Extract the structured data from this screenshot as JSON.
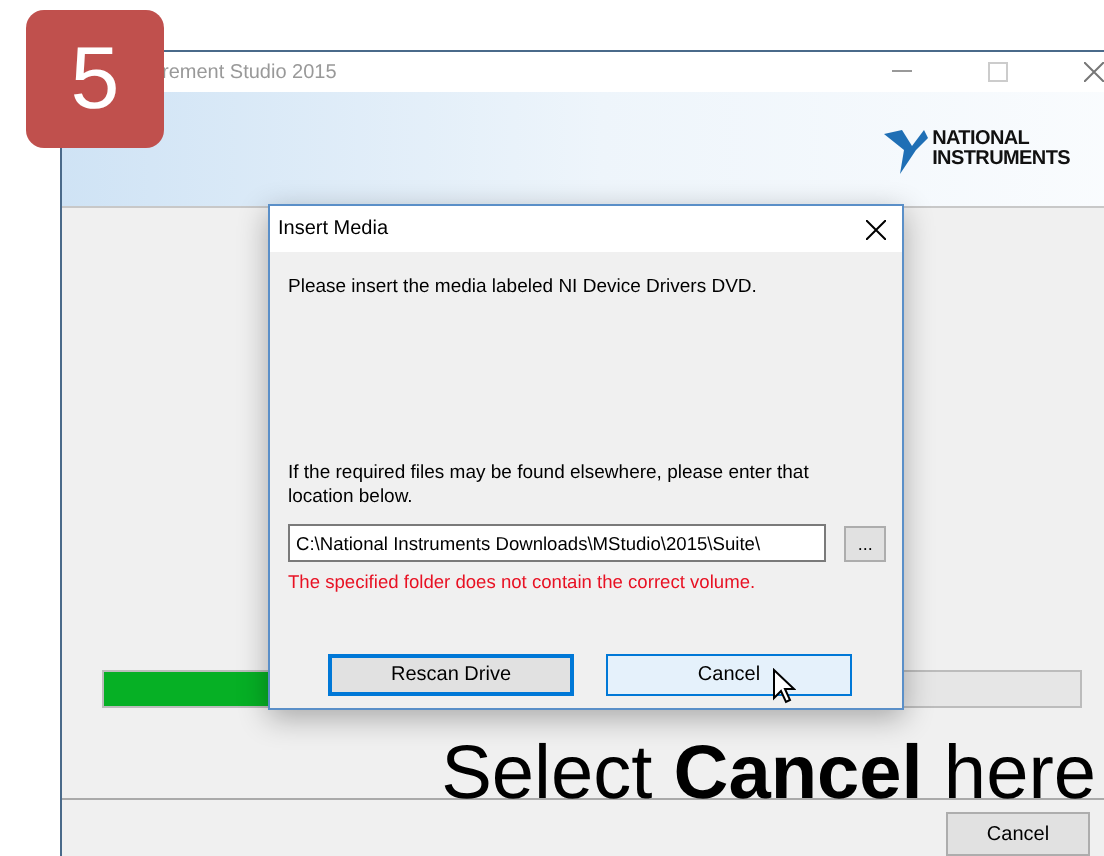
{
  "step_badge": "5",
  "window": {
    "title": "rement Studio 2015",
    "logo": [
      "NATIONAL",
      "INSTRUMENTS"
    ],
    "progress": {
      "level": 0.17
    },
    "buttons": [
      {
        "label": "Cancel"
      }
    ]
  },
  "dialog": {
    "title": "Insert Media",
    "message": "Please insert the media labeled NI Device Drivers DVD.",
    "hint": "If the required files may be found elsewhere, please enter that location below.",
    "path": "C:\\National Instruments Downloads\\MStudio\\2015\\Suite\\",
    "browse": "...",
    "error": "The specified folder does not contain the correct volume.",
    "buttons": [
      {
        "label": "Rescan Drive",
        "focused": true
      },
      {
        "label": "Cancel",
        "focused": false
      }
    ]
  },
  "caption": "Select **Cancel** here"
}
